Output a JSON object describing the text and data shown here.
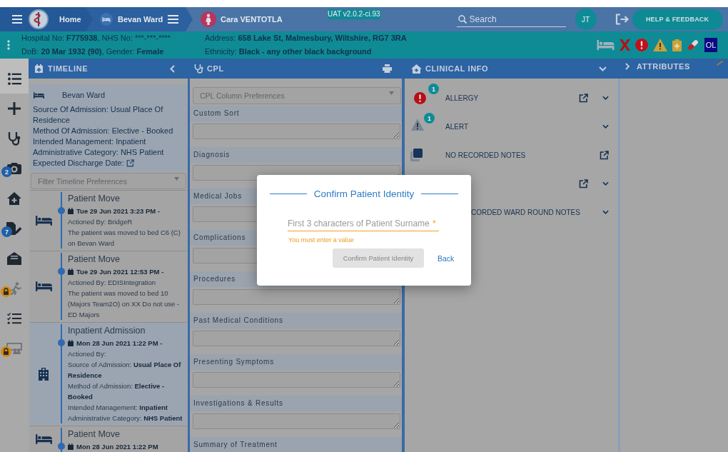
{
  "nav": {
    "breadcrumbs": [
      {
        "kind": "home",
        "label": "Home"
      },
      {
        "kind": "ward",
        "label": "Bevan Ward"
      },
      {
        "kind": "patient",
        "label": "Cara VENTOTLA"
      }
    ],
    "version": "UAT v2.0.2-ci.93",
    "search": {
      "placeholder": "Search"
    },
    "user_initials": "JT",
    "help_button": "HELP & FEEDBACK"
  },
  "patient_banner": {
    "columns": [
      [
        [
          {
            "text": "Hospital No: ",
            "bold": false
          },
          {
            "text": "F775938",
            "bold": true
          },
          {
            "text": ", NHS No: ***-***-****",
            "bold": false
          }
        ],
        [
          {
            "text": "DoB: ",
            "bold": false
          },
          {
            "text": "20 Mar 1932 (90)",
            "bold": true
          },
          {
            "text": ", Gender: ",
            "bold": false
          },
          {
            "text": "Female",
            "bold": true
          }
        ]
      ],
      [
        [
          {
            "text": "Address: ",
            "bold": false
          },
          {
            "text": "658 Lake St, Malmesbury, Wiltshire, RG7 3RA",
            "bold": true
          }
        ],
        [
          {
            "text": "Ethnicity: ",
            "bold": false
          },
          {
            "text": "Black - any other black background",
            "bold": true
          }
        ]
      ]
    ],
    "flag_badge": "OL"
  },
  "sidebar": {
    "items": [
      {
        "selected": true,
        "locked": false
      },
      {
        "selected": false,
        "locked": false
      },
      {
        "selected": false,
        "locked": false
      },
      {
        "selected": false,
        "locked": false,
        "badge": "2"
      },
      {
        "selected": false,
        "locked": false
      },
      {
        "selected": false,
        "locked": false,
        "badge": "7"
      },
      {
        "selected": false,
        "locked": false
      },
      {
        "selected": false,
        "locked": true
      },
      {
        "selected": false,
        "locked": false
      },
      {
        "selected": false,
        "locked": true
      }
    ]
  },
  "timeline": {
    "title": "TIMELINE",
    "summary": {
      "ward": "Bevan Ward",
      "lines": [
        "Source Of Admission: Usual Place Of Residence",
        "Method Of Admission: Elective - Booked",
        "Intended Management: Inpatient",
        "Administrative Category: NHS Patient"
      ],
      "discharge_label": "Expected Discharge Date:"
    },
    "filter": {
      "placeholder": "Filter Timeline Preferences"
    },
    "entries": [
      {
        "kind": "move",
        "title": "Patient Move",
        "date": "Tue 29 Jun 2021 3:23 PM -",
        "lines": [
          "Actioned By: BridgeR",
          "The patient was moved to bed C6 (C) on Bevan Ward"
        ]
      },
      {
        "kind": "move",
        "title": "Patient Move",
        "date": "Tue 29 Jun 2021 12:53 PM -",
        "lines": [
          "Actioned By: EDISIntegration",
          "The patient was moved to bed 10 (Majors Team2O) on XX Do not use - ED Majors"
        ]
      },
      {
        "kind": "admission",
        "title": "Inpatient Admission",
        "date": "Mon 28 Jun 2021 1:22 PM -",
        "lines": [
          "Actioned By:",
          "Source of Admission: **Usual Place Of Residence**",
          "Method of Admission: **Elective - Booked**",
          "Intended Management: **Inpatient**",
          "Administrative Category: **NHS Patient**"
        ]
      },
      {
        "kind": "move",
        "title": "Patient Move",
        "date": "Mon 28 Jun 2021 1:22 PM"
      }
    ]
  },
  "cpl": {
    "title": "CPL",
    "preferences": {
      "placeholder": "CPL Column Preferences"
    },
    "sections": [
      "Custom Sort",
      "Diagnosis",
      "Medical Jobs",
      "Complications",
      "Procedures",
      "Past Medical Conditions",
      "Presenting Symptoms",
      "Investigations & Results",
      "Summary of Treatment"
    ]
  },
  "clinical_info": {
    "title": "CLINICAL INFO",
    "rows": [
      {
        "kind": "allergy",
        "label": "ALLERGY",
        "count": "1",
        "external_link": true,
        "expandable": true
      },
      {
        "kind": "alert",
        "label": "ALERT",
        "count": "1",
        "external_link": false,
        "expandable": true
      },
      {
        "kind": "notes",
        "label": "NO RECORDED NOTES",
        "external_link": true,
        "expandable": false
      },
      {
        "external_link": true,
        "expandable": true
      },
      {
        "label": "CORDED WARD ROUND NOTES",
        "external_link": false,
        "expandable": true
      }
    ]
  },
  "attributes": {
    "title": "ATTRIBUTES"
  },
  "dialog": {
    "title": "Confirm Patient Identity",
    "field": {
      "placeholder": "First 3 characters of Patient Surname",
      "required_mark": "*",
      "error": "You must enter a value"
    },
    "confirm_button": {
      "label": "Confirm Patient Identity",
      "disabled": true
    },
    "back_link": "Back"
  }
}
